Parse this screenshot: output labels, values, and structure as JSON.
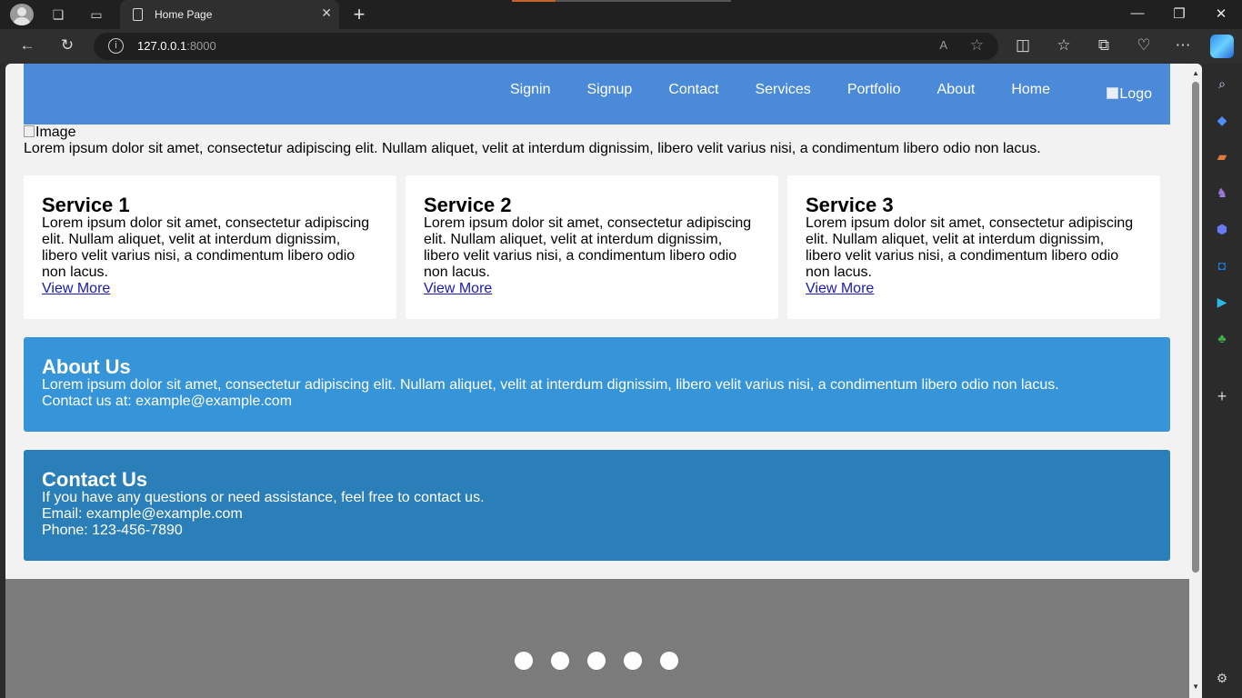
{
  "browser": {
    "tab_title": "Home Page",
    "url_host": "127.0.0.1",
    "url_port": ":8000"
  },
  "header": {
    "menu": [
      "Signin",
      "Signup",
      "Contact",
      "Services",
      "Portfolio",
      "About",
      "Home"
    ],
    "logo_alt": "Logo"
  },
  "hero": {
    "image_alt": "Image",
    "intro": "Lorem ipsum dolor sit amet, consectetur adipiscing elit. Nullam aliquet, velit at interdum dignissim, libero velit varius nisi, a condimentum libero odio non lacus."
  },
  "services": [
    {
      "title": "Service 1",
      "text": "Lorem ipsum dolor sit amet, consectetur adipiscing elit. Nullam aliquet, velit at interdum dignissim, libero velit varius nisi, a condimentum libero odio non lacus.",
      "link": "View More"
    },
    {
      "title": "Service 2",
      "text": "Lorem ipsum dolor sit amet, consectetur adipiscing elit. Nullam aliquet, velit at interdum dignissim, libero velit varius nisi, a condimentum libero odio non lacus.",
      "link": "View More"
    },
    {
      "title": "Service 3",
      "text": "Lorem ipsum dolor sit amet, consectetur adipiscing elit. Nullam aliquet, velit at interdum dignissim, libero velit varius nisi, a condimentum libero odio non lacus.",
      "link": "View More"
    }
  ],
  "about": {
    "title": "About Us",
    "text": "Lorem ipsum dolor sit amet, consectetur adipiscing elit. Nullam aliquet, velit at interdum dignissim, libero velit varius nisi, a condimentum libero odio non lacus.",
    "contact_line": "Contact us at: example@example.com"
  },
  "contact": {
    "title": "Contact Us",
    "intro": "If you have any questions or need assistance, feel free to contact us.",
    "email": "Email: example@example.com",
    "phone": "Phone: 123-456-7890"
  },
  "slider": {
    "dot_count": 5
  },
  "colors": {
    "header_blue": "#4a8ad9",
    "about_blue": "#3595d8",
    "contact_blue": "#2b7fb8",
    "slider_gray": "#7b7b7b"
  }
}
